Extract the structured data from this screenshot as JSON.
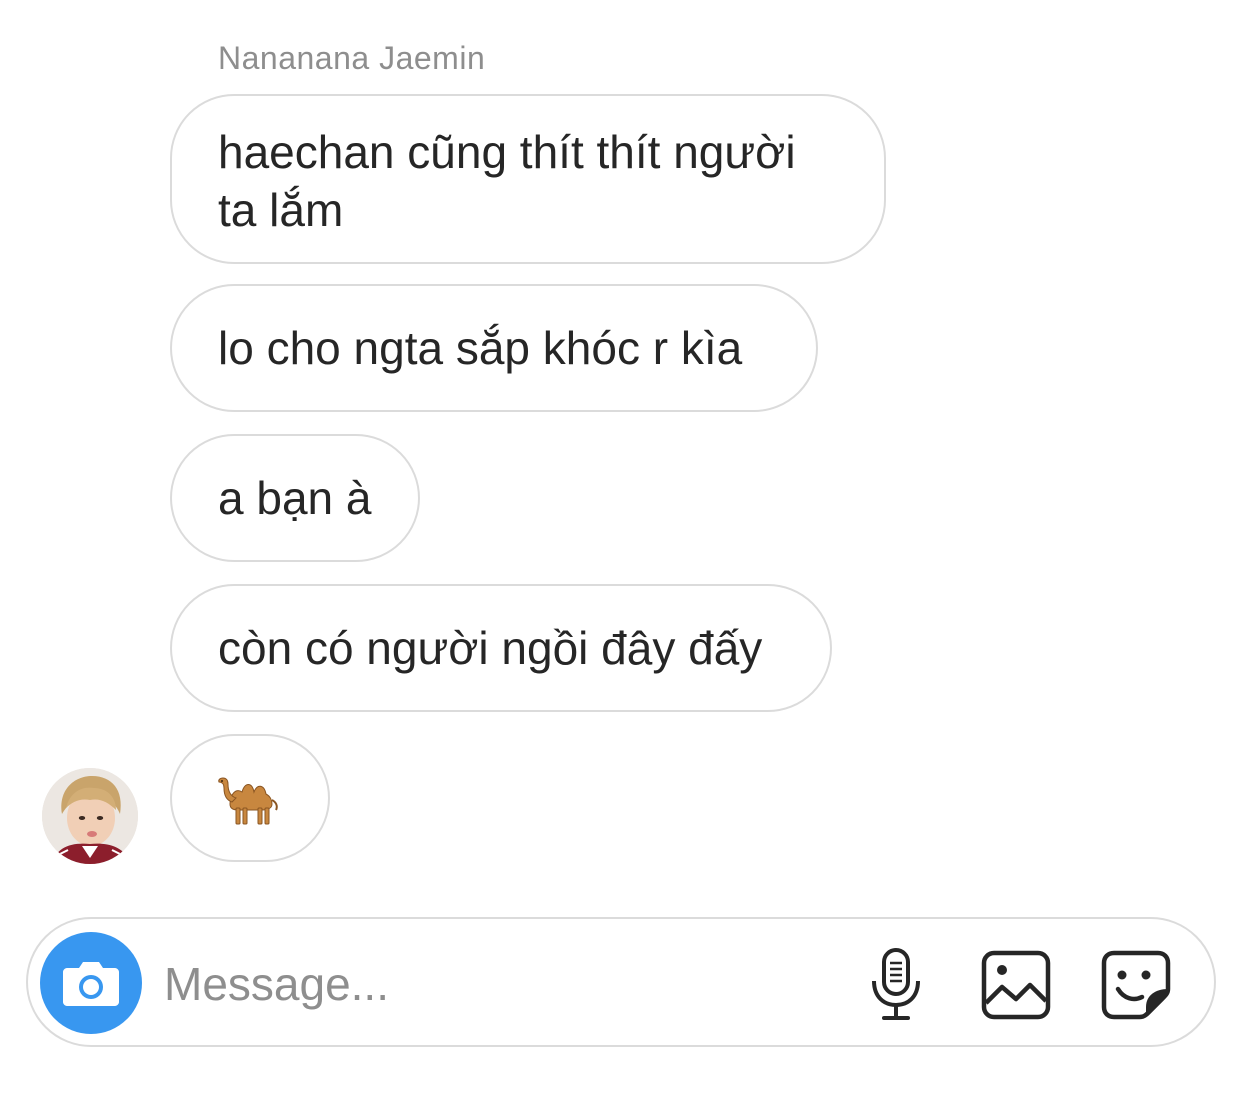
{
  "thread": {
    "sender_name": "Nananana Jaemin",
    "messages": [
      {
        "text": "haechan cũng thít thít người ta lắm"
      },
      {
        "text": "lo cho ngta sắp khóc r kìa"
      },
      {
        "text": "a bạn à"
      },
      {
        "text": "còn có người ngồi đây đấy"
      },
      {
        "emoji": "camel-icon"
      }
    ]
  },
  "composer": {
    "placeholder": "Message...",
    "accent_color": "#3897f0",
    "icons": [
      "camera-icon",
      "microphone-icon",
      "gallery-icon",
      "sticker-icon"
    ]
  }
}
